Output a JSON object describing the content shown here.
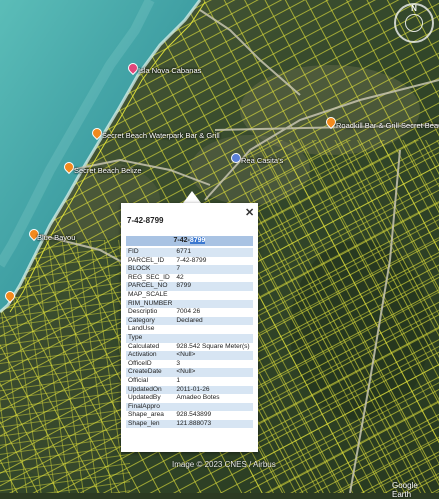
{
  "map": {
    "pois": [
      {
        "label": "Isla Nova Cabanas",
        "icon": "pink-pin-icon"
      },
      {
        "label": "Secret Beach Waterpark Bar & Grill",
        "icon": "orange-pin-icon"
      },
      {
        "label": "Roadkill Bar & Grill Secret Beach",
        "icon": "orange-pin-icon"
      },
      {
        "label": "Secret Beach Belize",
        "icon": "orange-pin-icon"
      },
      {
        "label": "Rea Casita's",
        "icon": "blue-pin-icon"
      },
      {
        "label": "Blue Bayou",
        "icon": "orange-pin-icon"
      }
    ],
    "attribution": "Image © 2023 CNES / Airbus",
    "logo": "Google Earth",
    "compass_label": "N"
  },
  "popup": {
    "title": "7-42-8799",
    "close_label": "✕",
    "header_prefix": "7-42-",
    "header_highlight": "8799",
    "rows": [
      {
        "key": "FID",
        "value": "6771"
      },
      {
        "key": "PARCEL_ID",
        "value": "7-42-8799"
      },
      {
        "key": "BLOCK",
        "value": "7"
      },
      {
        "key": "REG_SEC_ID",
        "value": "42"
      },
      {
        "key": "PARCEL_NO",
        "value": "8799"
      },
      {
        "key": "MAP_SCALE",
        "value": ""
      },
      {
        "key": "RIM_NUMBER",
        "value": ""
      },
      {
        "key": "Descriptio",
        "value": "7004 26"
      },
      {
        "key": "Category",
        "value": "Declared"
      },
      {
        "key": "LandUse",
        "value": ""
      },
      {
        "key": "Type",
        "value": ""
      },
      {
        "key": "Calculated",
        "value": "928.542 Square Meter(s)"
      },
      {
        "key": "Activation",
        "value": "<Null>"
      },
      {
        "key": "OfficeID",
        "value": "3"
      },
      {
        "key": "CreateDate",
        "value": "<Null>"
      },
      {
        "key": "Official",
        "value": "1"
      },
      {
        "key": "UpdatedOn",
        "value": "2011-01-26"
      },
      {
        "key": "UpdatedBy",
        "value": "Amadeo Botes"
      },
      {
        "key": "FinalAppro",
        "value": ""
      },
      {
        "key": "Shape_area",
        "value": "928.543899"
      },
      {
        "key": "Shape_len",
        "value": "121.888073"
      }
    ]
  },
  "colors": {
    "parcel_lines": "#e8e83a",
    "sea": "#3f9fa3",
    "land": "#2f4a26",
    "popup_header": "#a9c3e3",
    "popup_highlight": "#3b78d0"
  }
}
